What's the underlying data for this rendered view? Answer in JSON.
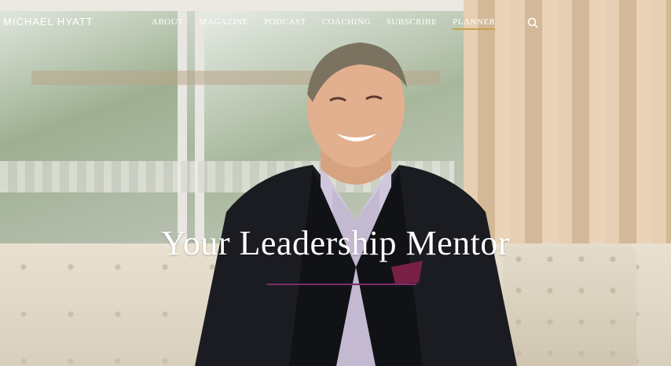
{
  "site": {
    "logo_text": "MICHAEL HYATT"
  },
  "nav": {
    "items": [
      {
        "label": "ABOUT"
      },
      {
        "label": "MAGAZINE"
      },
      {
        "label": "PODCAST"
      },
      {
        "label": "COACHING"
      },
      {
        "label": "SUBSCRIBE"
      },
      {
        "label": "PLANNER",
        "active": true
      }
    ],
    "search_icon": "search-icon",
    "accent_color": "#c8a24a"
  },
  "hero": {
    "headline": "Your Leadership Mentor",
    "rule_color": "#7b2d6b"
  }
}
